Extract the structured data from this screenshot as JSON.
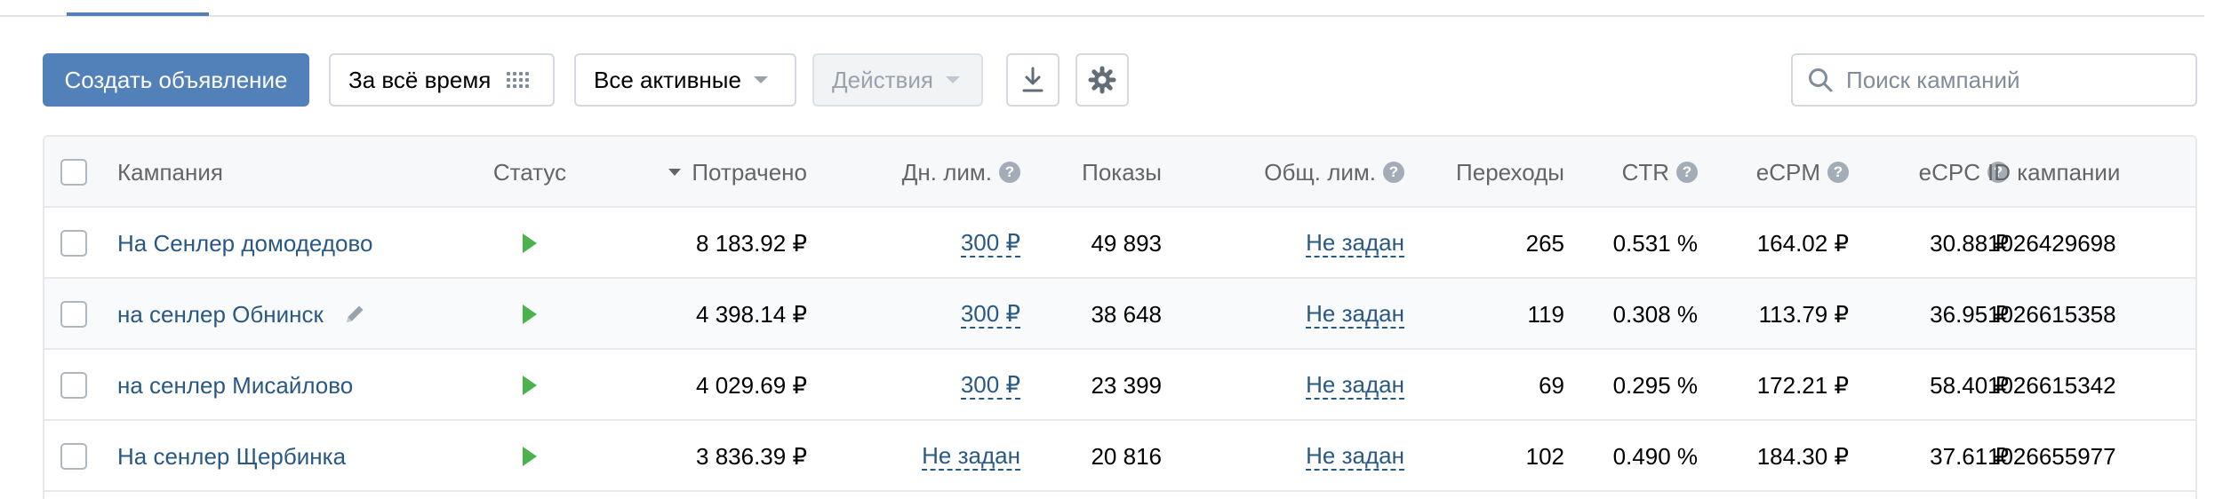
{
  "toolbar": {
    "create_label": "Создать объявление",
    "period_label": "За всё время",
    "filter_label": "Все активные",
    "actions_label": "Действия"
  },
  "search": {
    "placeholder": "Поиск кампаний",
    "value": ""
  },
  "table": {
    "headers": {
      "campaign": "Кампания",
      "status": "Статус",
      "spent": "Потрачено",
      "day_limit": "Дн. лим.",
      "shows": "Показы",
      "general_limit": "Общ. лим.",
      "clicks": "Переходы",
      "ctr": "CTR",
      "ecpm": "eCPM",
      "ecpc": "eCPC",
      "id": "ID кампании"
    },
    "help_glyph": "?",
    "rows": [
      {
        "name": "На Сенлер домодедово",
        "spent": "8 183.92 ₽",
        "day_limit": "300 ₽",
        "shows": "49 893",
        "general_limit": "Не задан",
        "clicks": "265",
        "ctr": "0.531 %",
        "ecpm": "164.02 ₽",
        "ecpc": "30.88 ₽",
        "id": "1026429698"
      },
      {
        "name": "на сенлер Обнинск",
        "spent": "4 398.14 ₽",
        "day_limit": "300 ₽",
        "shows": "38 648",
        "general_limit": "Не задан",
        "clicks": "119",
        "ctr": "0.308 %",
        "ecpm": "113.79 ₽",
        "ecpc": "36.95 ₽",
        "id": "1026615358"
      },
      {
        "name": "на сенлер Мисайлово",
        "spent": "4 029.69 ₽",
        "day_limit": "300 ₽",
        "shows": "23 399",
        "general_limit": "Не задан",
        "clicks": "69",
        "ctr": "0.295 %",
        "ecpm": "172.21 ₽",
        "ecpc": "58.40 ₽",
        "id": "1026615342"
      },
      {
        "name": "На сенлер Щербинка",
        "spent": "3 836.39 ₽",
        "day_limit": "Не задан",
        "shows": "20 816",
        "general_limit": "Не задан",
        "clicks": "102",
        "ctr": "0.490 %",
        "ecpm": "184.30 ₽",
        "ecpc": "37.61 ₽",
        "id": "1026655977"
      }
    ]
  }
}
